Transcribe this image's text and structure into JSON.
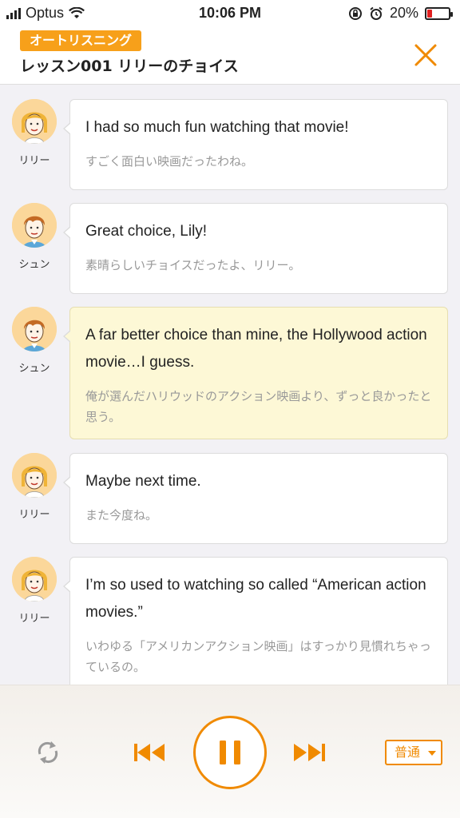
{
  "status_bar": {
    "carrier": "Optus",
    "time": "10:06 PM",
    "battery": "20%"
  },
  "header": {
    "badge": "オートリスニング",
    "title": "レッスン001 リリーのチョイス",
    "close_icon": "close-icon"
  },
  "messages": [
    {
      "speaker": "リリー",
      "en": "I had so much fun watching that movie!",
      "ja": "すごく面白い映画だったわね。",
      "active": false
    },
    {
      "speaker": "シュン",
      "en": "Great choice, Lily!",
      "ja": "素晴らしいチョイスだったよ、リリー。",
      "active": false
    },
    {
      "speaker": "シュン",
      "en": "A far better choice than mine, the Hollywood action movie…I guess.",
      "ja": "俺が選んだハリウッドのアクション映画より、ずっと良かったと思う。",
      "active": true
    },
    {
      "speaker": "リリー",
      "en": "Maybe next time.",
      "ja": "また今度ね。",
      "active": false
    },
    {
      "speaker": "リリー",
      "en": "I’m so used to watching so called “American action movies.”",
      "ja": "いわゆる「アメリカンアクション映画」はすっかり見慣れちゃっているの。",
      "active": false
    }
  ],
  "player": {
    "speed_label": "普通",
    "icons": [
      "repeat-icon",
      "previous-icon",
      "pause-icon",
      "next-icon",
      "dropdown-caret-icon"
    ]
  },
  "colors": {
    "accent": "#f08a00",
    "badge": "#f7a01a",
    "active_bubble": "#fdf8d6"
  }
}
